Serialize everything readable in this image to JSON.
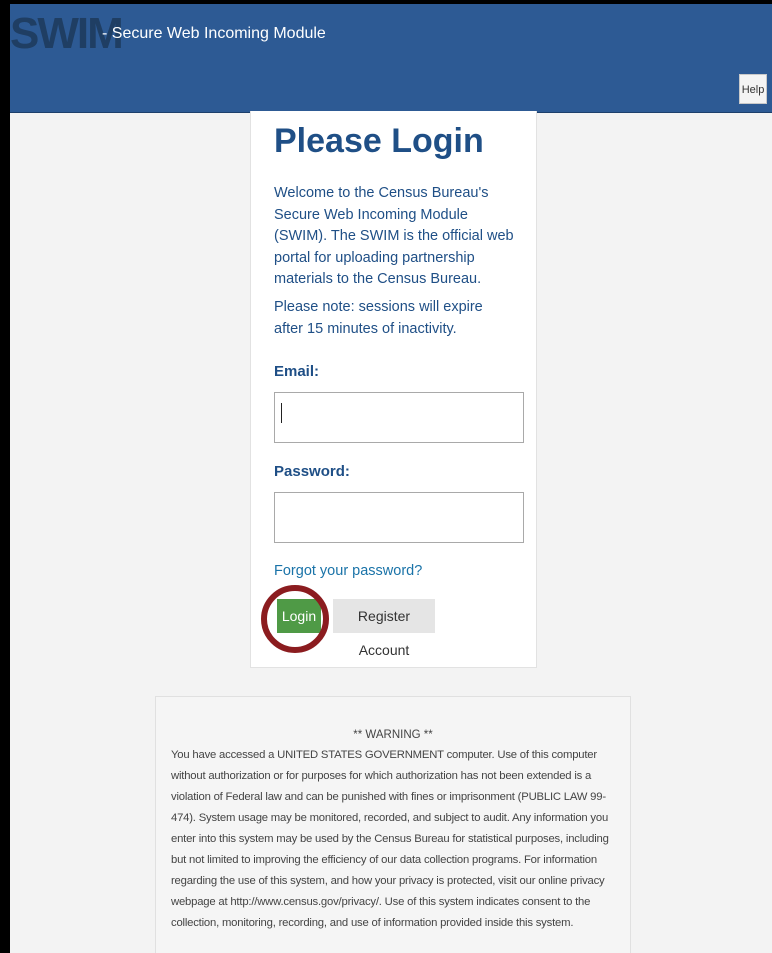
{
  "header": {
    "logo": "SWIM",
    "subtitle": "- Secure Web Incoming Module",
    "help_label": "Help",
    "bg_color": "#2d5a94"
  },
  "login": {
    "title": "Please Login",
    "intro": "Welcome to the Census Bureau's Secure Web Incoming Module (SWIM). The SWIM is the official web portal for uploading partnership materials to the Census Bureau.",
    "session_note": "Please note: sessions will expire after 15 minutes of inactivity.",
    "email_label": "Email:",
    "email_value": "",
    "password_label": "Password:",
    "password_value": "",
    "forgot_link": "Forgot your password?",
    "login_button": "Login",
    "register_button": "Register Account",
    "login_button_color": "#4f9a46",
    "highlight_color": "#8b1c1f"
  },
  "warning": {
    "title": "** WARNING **",
    "text": "You have accessed a UNITED STATES GOVERNMENT computer. Use of this computer without authorization or for purposes for which authorization has not been extended is a violation of Federal law and can be punished with fines or imprisonment (PUBLIC LAW 99-474). System usage may be monitored, recorded, and subject to audit. Any information you enter into this system may be used by the Census Bureau for statistical purposes, including but not limited to improving the efficiency of our data collection programs. For information regarding the use of this system, and how your privacy is protected, visit our online privacy webpage at http://www.census.gov/privacy/. Use of this system indicates consent to the collection, monitoring, recording, and use of information provided inside this system."
  }
}
